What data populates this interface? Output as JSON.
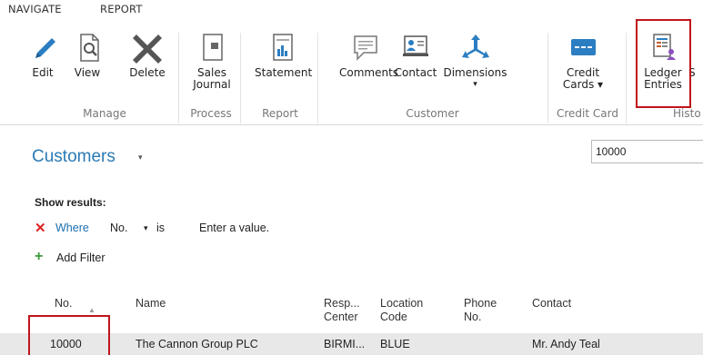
{
  "ribbon": {
    "tabs": [
      "NAVIGATE",
      "REPORT"
    ],
    "buttons": {
      "edit": "Edit",
      "view": "View",
      "delete": "Delete",
      "sales_journal_1": "Sales",
      "sales_journal_2": "Journal",
      "statement": "Statement",
      "comments": "Comments",
      "contact": "Contact",
      "dimensions": "Dimensions",
      "dimensions_caret": "▾",
      "credit_cards_1": "Credit",
      "credit_cards_2": "Cards ▾",
      "ledger_entries_1": "Ledger",
      "ledger_entries_2": "Entries",
      "cut_off": "S"
    },
    "groups": {
      "manage": "Manage",
      "process": "Process",
      "report": "Report",
      "customer": "Customer",
      "credit_card": "Credit Card",
      "history": "Histo"
    },
    "accent_color": "#2a7ab5",
    "highlight_color": "#c0141b"
  },
  "page": {
    "title": "Customers",
    "title_caret": "▾",
    "search_value": "10000"
  },
  "filters": {
    "show_results": "Show results:",
    "where": "Where",
    "field": "No.",
    "field_caret": "▾",
    "operator": "is",
    "value_placeholder": "Enter a value.",
    "add_filter": "Add Filter"
  },
  "table": {
    "headers": {
      "no": "No.",
      "name": "Name",
      "resp_1": "Resp...",
      "resp_2": "Center",
      "loc_1": "Location",
      "loc_2": "Code",
      "phone_1": "Phone",
      "phone_2": "No.",
      "contact": "Contact"
    },
    "rows": [
      {
        "no": "10000",
        "name": "The Cannon Group PLC",
        "resp": "BIRMI...",
        "location": "BLUE",
        "phone": "",
        "contact": "Mr. Andy Teal"
      }
    ]
  }
}
